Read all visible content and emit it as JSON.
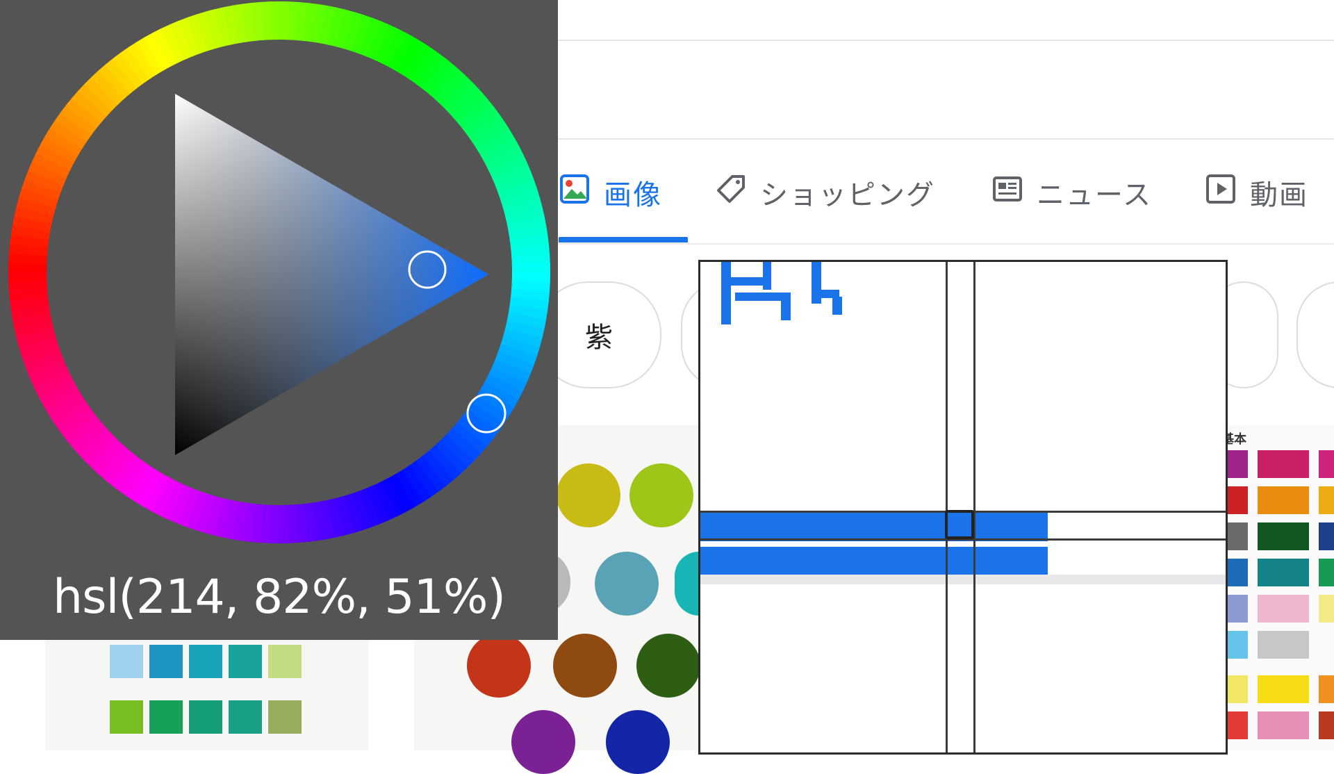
{
  "search": {
    "tabs": [
      {
        "label": "画像",
        "icon": "image-icon",
        "active": true
      },
      {
        "label": "ショッピング",
        "icon": "tag-icon",
        "active": false
      },
      {
        "label": "ニュース",
        "icon": "news-icon",
        "active": false
      },
      {
        "label": "動画",
        "icon": "play-icon",
        "active": false
      }
    ],
    "chips": [
      "紫"
    ],
    "accent_color": "#1a73e8"
  },
  "results": {
    "right_card_heading": "基本"
  },
  "color_picker": {
    "readout": "hsl(214, 82%, 51%)",
    "selected_color": "#2574e8",
    "hue": 214,
    "saturation_percent": 82,
    "lightness_percent": 51
  },
  "magnifier": {
    "sampled_color": "#1a73e8"
  }
}
